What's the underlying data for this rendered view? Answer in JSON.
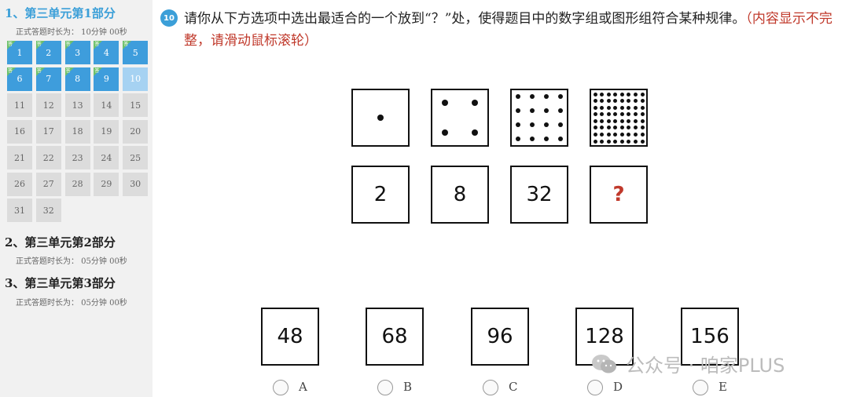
{
  "sidebar": {
    "sections": [
      {
        "title": "1、第三单元第1部分",
        "time": "正式答题时长为：  10分钟 00秒"
      },
      {
        "title": "2、第三单元第2部分",
        "time": "正式答题时长为：  05分钟 00秒"
      },
      {
        "title": "3、第三单元第3部分",
        "time": "正式答题时长为：  05分钟 00秒"
      }
    ],
    "questions": [
      {
        "n": "1",
        "state": "answered"
      },
      {
        "n": "2",
        "state": "answered"
      },
      {
        "n": "3",
        "state": "answered"
      },
      {
        "n": "4",
        "state": "answered"
      },
      {
        "n": "5",
        "state": "answered"
      },
      {
        "n": "6",
        "state": "answered"
      },
      {
        "n": "7",
        "state": "answered"
      },
      {
        "n": "8",
        "state": "answered"
      },
      {
        "n": "9",
        "state": "answered"
      },
      {
        "n": "10",
        "state": "current"
      },
      {
        "n": "11",
        "state": "todo"
      },
      {
        "n": "12",
        "state": "todo"
      },
      {
        "n": "13",
        "state": "todo"
      },
      {
        "n": "14",
        "state": "todo"
      },
      {
        "n": "15",
        "state": "todo"
      },
      {
        "n": "16",
        "state": "todo"
      },
      {
        "n": "17",
        "state": "todo"
      },
      {
        "n": "18",
        "state": "todo"
      },
      {
        "n": "19",
        "state": "todo"
      },
      {
        "n": "20",
        "state": "todo"
      },
      {
        "n": "21",
        "state": "todo"
      },
      {
        "n": "22",
        "state": "todo"
      },
      {
        "n": "23",
        "state": "todo"
      },
      {
        "n": "24",
        "state": "todo"
      },
      {
        "n": "25",
        "state": "todo"
      },
      {
        "n": "26",
        "state": "todo"
      },
      {
        "n": "27",
        "state": "todo"
      },
      {
        "n": "28",
        "state": "todo"
      },
      {
        "n": "29",
        "state": "todo"
      },
      {
        "n": "30",
        "state": "todo"
      },
      {
        "n": "31",
        "state": "todo"
      },
      {
        "n": "32",
        "state": "todo"
      }
    ],
    "flag_mark": "答"
  },
  "question": {
    "number": "10",
    "text": "请你从下方选项中选出最适合的一个放到“？”处，使得题目中的数字组或图形组符合某种规律。",
    "note": "（内容显示不完整，请滑动鼠标滚轮）",
    "dot_grids": [
      1,
      2,
      4,
      8
    ],
    "numbers": [
      "2",
      "8",
      "32",
      "?"
    ]
  },
  "options": [
    {
      "value": "48",
      "label": "A"
    },
    {
      "value": "68",
      "label": "B"
    },
    {
      "value": "96",
      "label": "C"
    },
    {
      "value": "128",
      "label": "D"
    },
    {
      "value": "156",
      "label": "E"
    }
  ],
  "watermark": {
    "text": "公众号 · 咱家PLUS",
    "icon": "wechat-icon"
  },
  "colors": {
    "accent": "#3b9fd8",
    "answered": "#3e9ddc",
    "current": "#a6d2f2",
    "todo": "#dcdcdc",
    "note": "#c0392b",
    "flag": "#6cc06a"
  }
}
